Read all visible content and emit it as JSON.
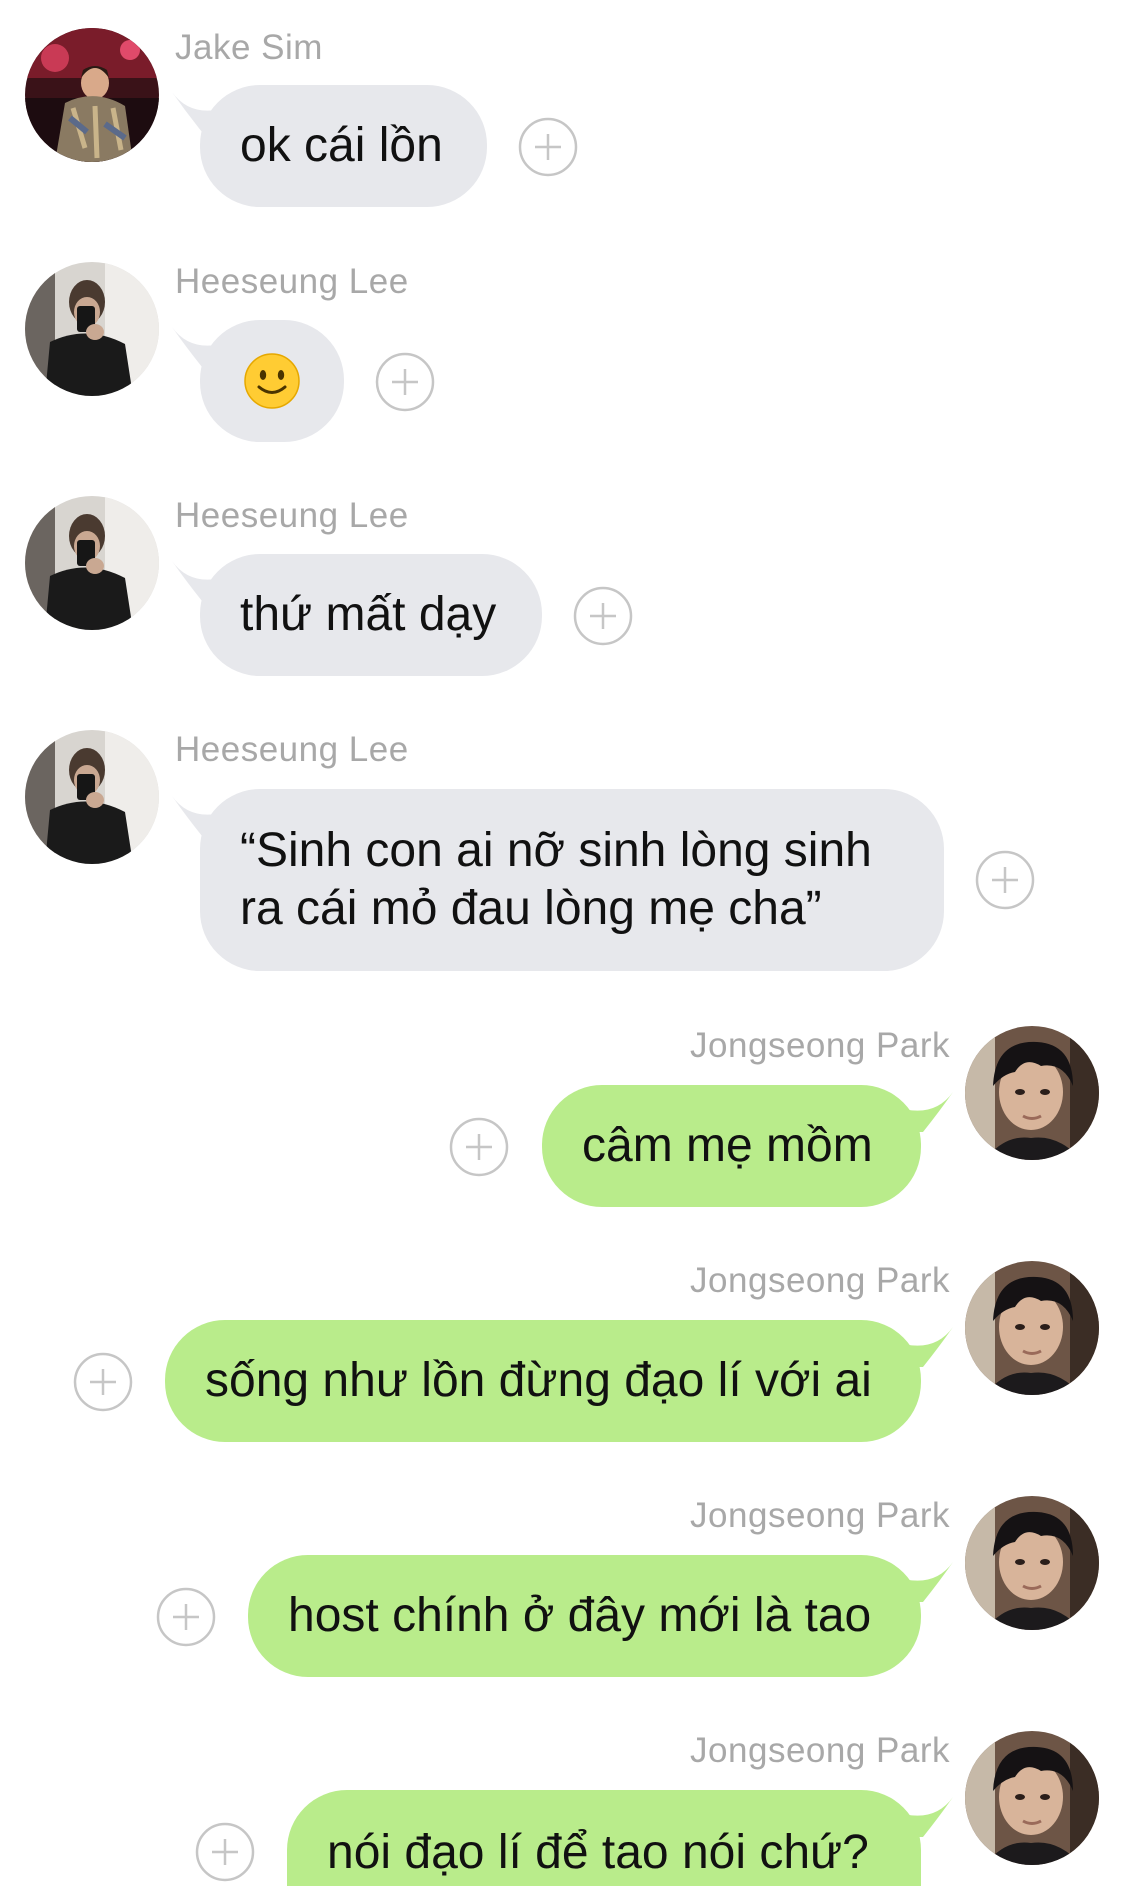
{
  "messages": [
    {
      "sender": "Jake Sim",
      "text": "ok cái lồn",
      "side": "left"
    },
    {
      "sender": "Heeseung Lee",
      "emoji": "slightly-smiling-face-icon",
      "side": "left"
    },
    {
      "sender": "Heeseung Lee",
      "text": "thứ mất dạy",
      "side": "left"
    },
    {
      "sender": "Heeseung Lee",
      "text": "“Sinh con ai nỡ sinh lòng sinh ra cái mỏ đau lòng mẹ cha”",
      "side": "left"
    },
    {
      "sender": "Jongseong Park",
      "text": "câm mẹ mồm",
      "side": "right"
    },
    {
      "sender": "Jongseong Park",
      "text": "sống như lồn đừng đạo lí với ai",
      "side": "right"
    },
    {
      "sender": "Jongseong Park",
      "text": "host chính ở đây mới là tao",
      "side": "right"
    },
    {
      "sender": "Jongseong Park",
      "text": "nói đạo lí để tao nói chứ?",
      "side": "right"
    }
  ],
  "colors": {
    "incoming_bubble": "#e7e8ec",
    "outgoing_bubble": "#b9ec8b",
    "sender_name": "#a8a8a8",
    "add_reaction_icon": "#c6c6c6"
  },
  "icons": {
    "add_reaction": "add-reaction-icon"
  }
}
